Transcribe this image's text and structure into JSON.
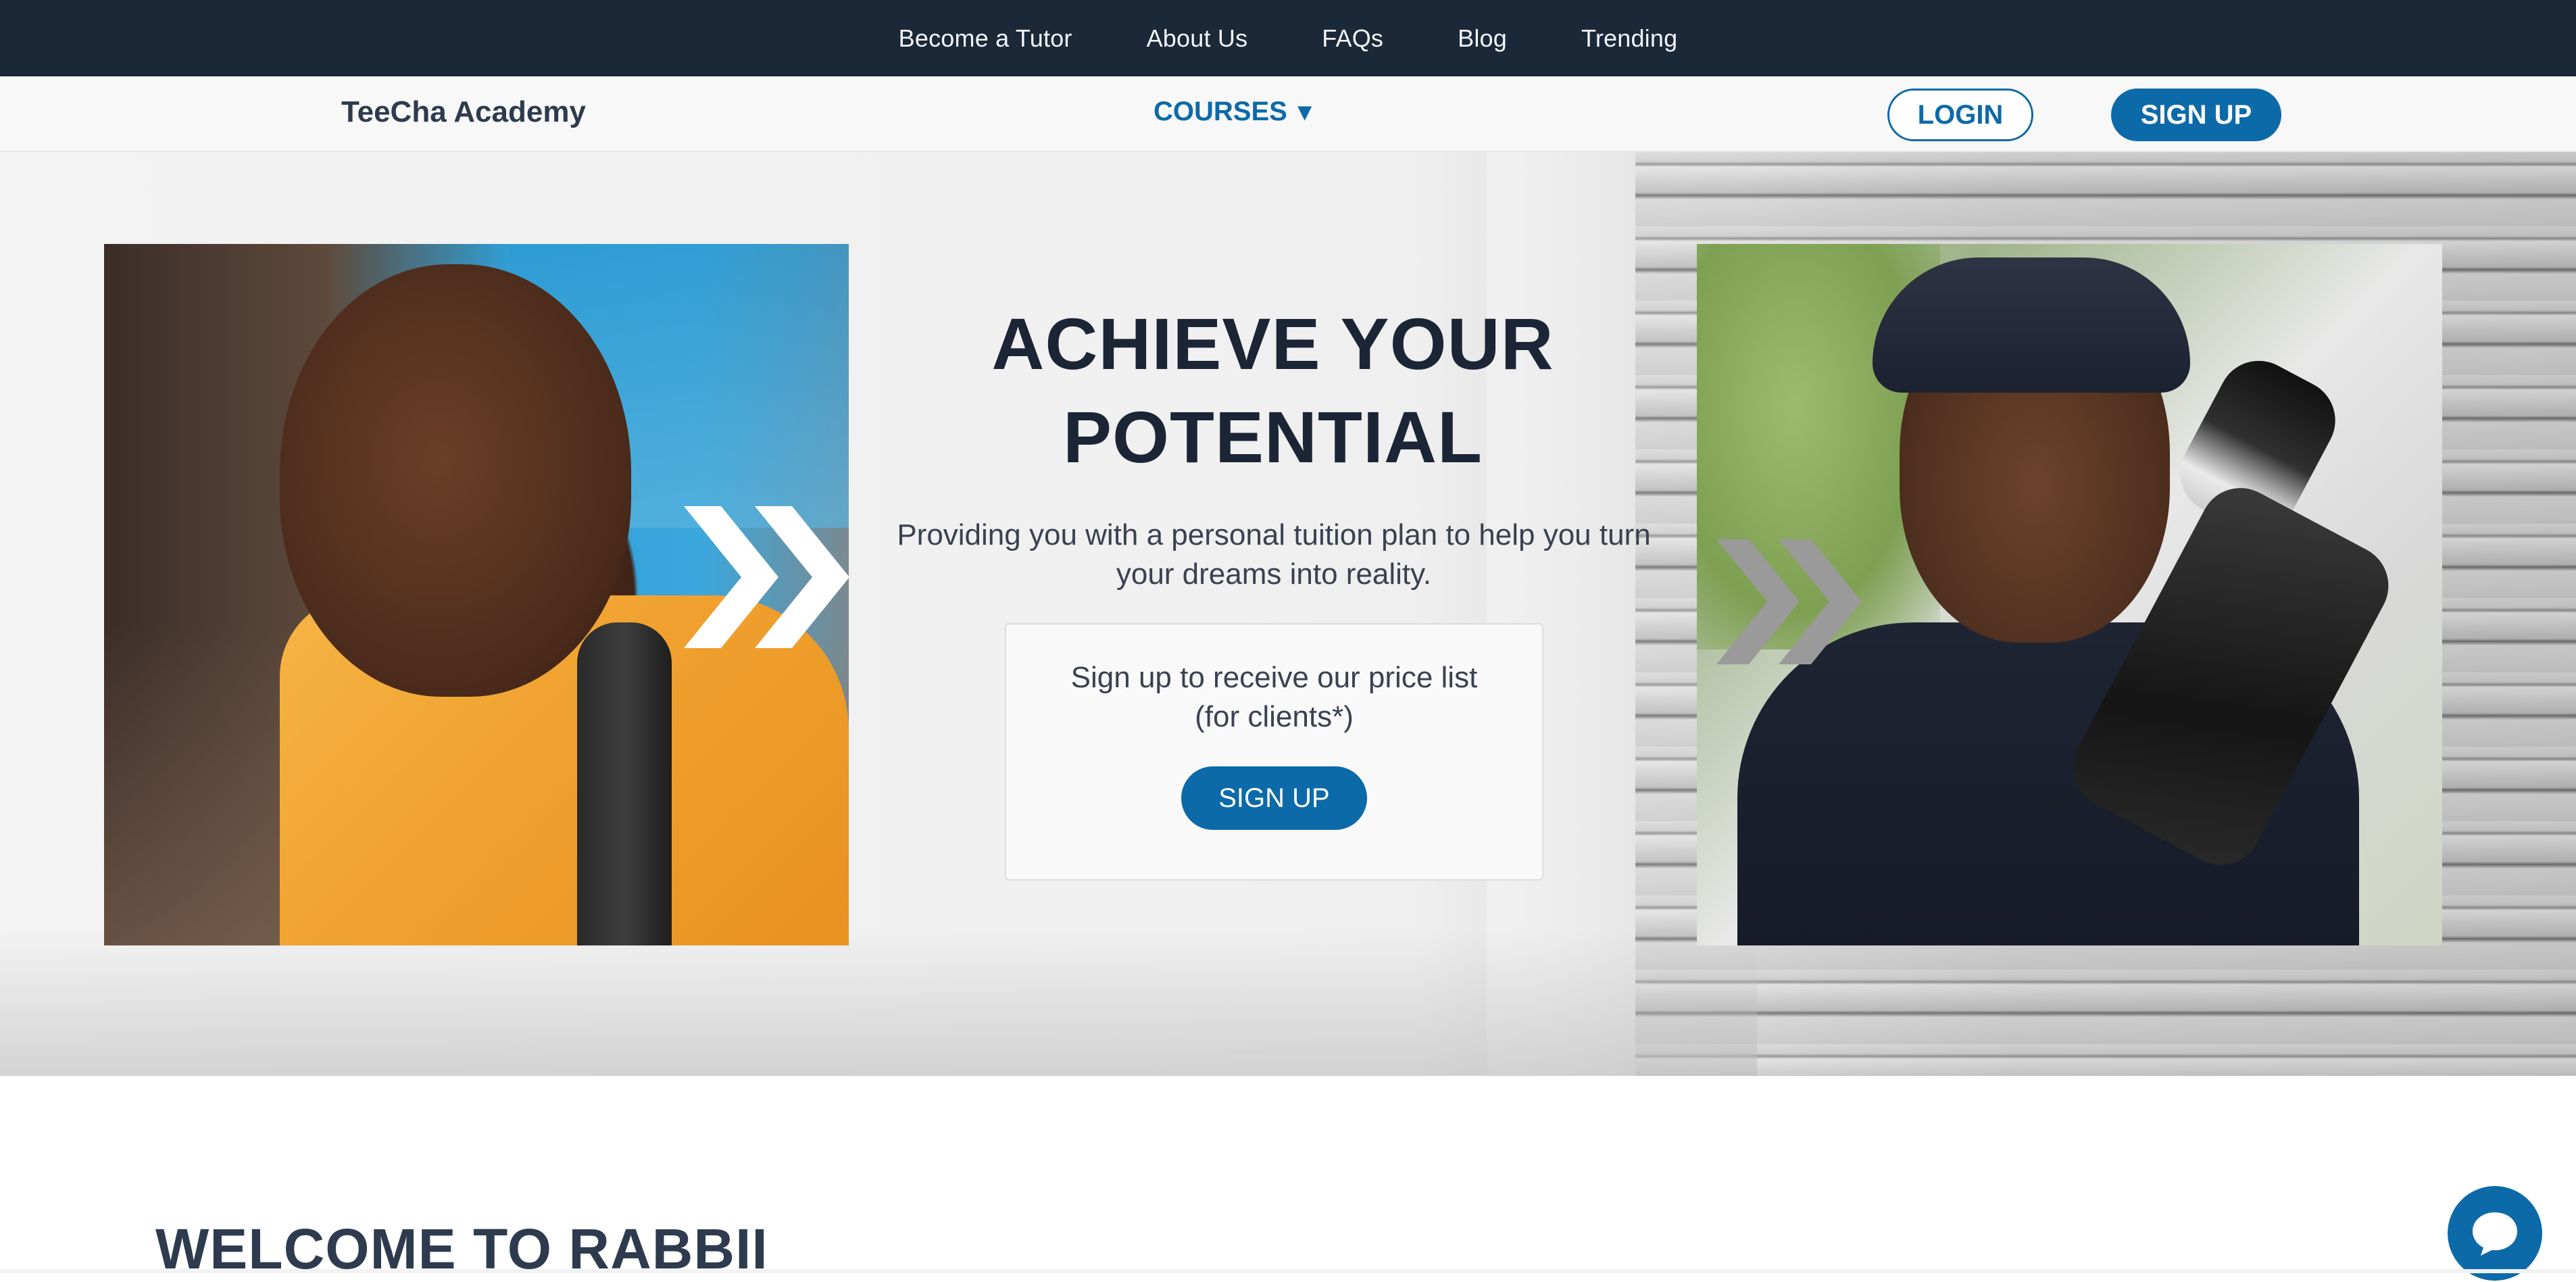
{
  "topnav": {
    "links": [
      "Become a Tutor",
      "About Us",
      "FAQs",
      "Blog",
      "Trending"
    ]
  },
  "navbar": {
    "brand": "TeeCha Academy",
    "courses_label": "COURSES",
    "courses_caret": "▼",
    "login_label": "LOGIN",
    "signup_label": "SIGN UP"
  },
  "hero": {
    "title_line1": "ACHIEVE YOUR",
    "title_line2": "POTENTIAL",
    "subtitle_line1": "Providing you with a personal tuition plan to help you turn",
    "subtitle_line2": "your dreams into reality.",
    "card": {
      "text_line1": "Sign up to receive our price list",
      "text_line2": "(for clients*)",
      "button_label": "SIGN UP"
    },
    "left_photo_icon": "student-photo",
    "right_photo_icon": "photographer-photo",
    "chevron_icon": "double-chevron-right-icon"
  },
  "welcome": {
    "heading": "WELCOME TO RABBII"
  },
  "chat": {
    "icon": "chat-bubble-icon"
  },
  "colors": {
    "topbar_bg": "#1b2838",
    "accent": "#0d6aa8",
    "heading": "#1c2535",
    "brand_text": "#2e3b4e"
  }
}
